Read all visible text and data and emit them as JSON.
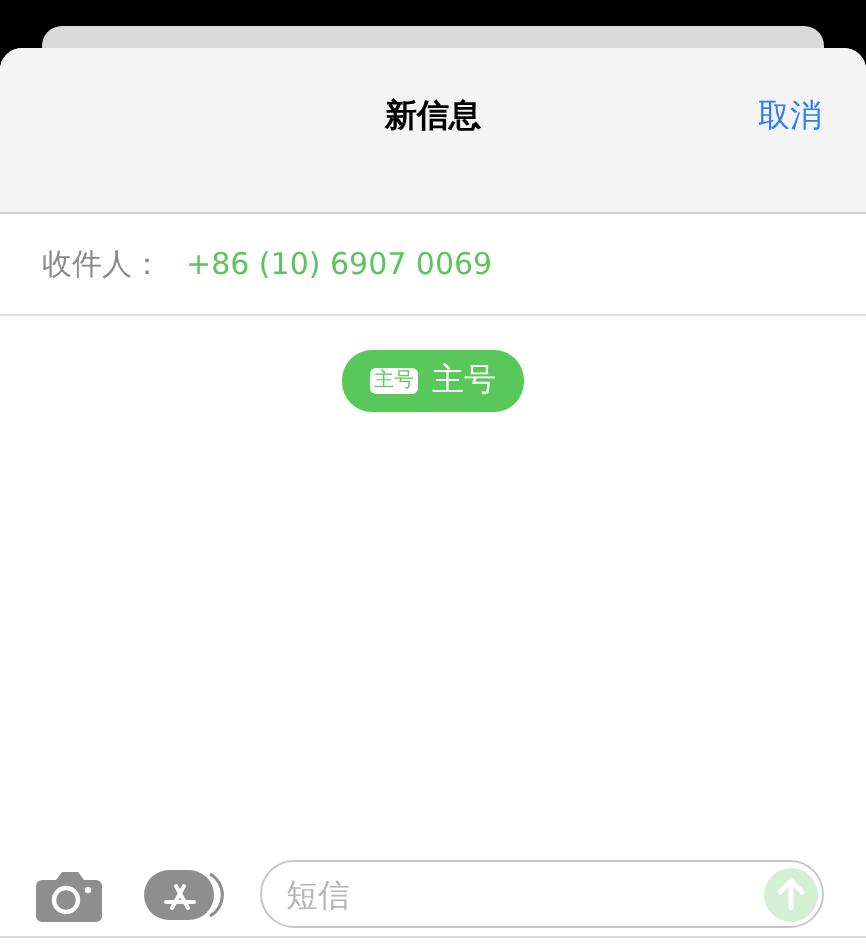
{
  "header": {
    "title": "新信息",
    "cancel": "取消"
  },
  "recipient": {
    "label": "收件人：",
    "value": "+86 (10) 6907 0069"
  },
  "sim_badge": {
    "tag": "主号",
    "label": "主号"
  },
  "composer": {
    "placeholder": "短信",
    "send_enabled": false
  }
}
